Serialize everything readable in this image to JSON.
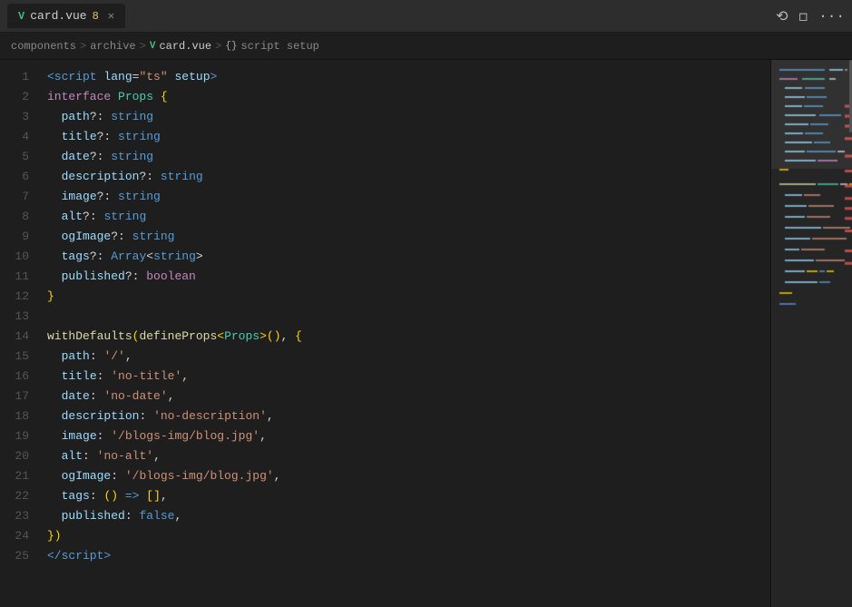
{
  "tab": {
    "label": "card.vue",
    "dirty": "8",
    "vue_prefix": "V"
  },
  "title_bar_actions": {
    "history": "⟳",
    "split": "⬜",
    "more": "···"
  },
  "breadcrumb": {
    "components": "components",
    "archive": "archive",
    "file": "card.vue",
    "section": "script setup"
  },
  "code_lines": [
    {
      "num": 1,
      "html": "<span class='t-tag'>&lt;script</span> <span class='t-attr'>lang</span><span class='t-punc'>=</span><span class='t-str'>\"ts\"</span> <span class='t-attr'>setup</span><span class='t-tag'>&gt;</span>"
    },
    {
      "num": 2,
      "html": "<span class='t-kw'>interface</span> <span class='t-typename'>Props</span> <span class='t-bracket'>{</span>"
    },
    {
      "num": 3,
      "html": "  <span class='t-prop'>path</span><span class='t-punc'>?:</span> <span class='t-kw2'>string</span>"
    },
    {
      "num": 4,
      "html": "  <span class='t-prop'>title</span><span class='t-punc'>?:</span> <span class='t-kw2'>string</span>"
    },
    {
      "num": 5,
      "html": "  <span class='t-prop'>date</span><span class='t-punc'>?:</span> <span class='t-kw2'>string</span>"
    },
    {
      "num": 6,
      "html": "  <span class='t-prop'>description</span><span class='t-punc'>?:</span> <span class='t-kw2'>string</span>"
    },
    {
      "num": 7,
      "html": "  <span class='t-prop'>image</span><span class='t-punc'>?:</span> <span class='t-kw2'>string</span>"
    },
    {
      "num": 8,
      "html": "  <span class='t-prop'>alt</span><span class='t-punc'>?:</span> <span class='t-kw2'>string</span>"
    },
    {
      "num": 9,
      "html": "  <span class='t-prop'>ogImage</span><span class='t-punc'>?:</span> <span class='t-kw2'>string</span>"
    },
    {
      "num": 10,
      "html": "  <span class='t-prop'>tags</span><span class='t-punc'>?:</span> <span class='t-kw2'>Array</span><span class='t-punc'>&lt;</span><span class='t-kw2'>string</span><span class='t-punc'>&gt;</span>"
    },
    {
      "num": 11,
      "html": "  <span class='t-prop'>published</span><span class='t-punc'>?:</span> <span class='t-kw'>boolean</span>"
    },
    {
      "num": 12,
      "html": "<span class='t-bracket'>}</span>"
    },
    {
      "num": 13,
      "html": ""
    },
    {
      "num": 14,
      "html": "<span class='t-fn'>withDefaults</span><span class='t-bracket'>(</span><span class='t-fn'>defineProps</span><span class='t-bracket'>&lt;</span><span class='t-typename'>Props</span><span class='t-bracket'>&gt;()</span><span class='t-punc'>,</span> <span class='t-bracket'>{</span>"
    },
    {
      "num": 15,
      "html": "  <span class='t-prop'>path</span><span class='t-punc'>:</span> <span class='t-val'>'/'</span><span class='t-punc'>,</span>"
    },
    {
      "num": 16,
      "html": "  <span class='t-prop'>title</span><span class='t-punc'>:</span> <span class='t-val'>'no-title'</span><span class='t-punc'>,</span>"
    },
    {
      "num": 17,
      "html": "  <span class='t-prop'>date</span><span class='t-punc'>:</span> <span class='t-val'>'no-date'</span><span class='t-punc'>,</span>"
    },
    {
      "num": 18,
      "html": "  <span class='t-prop'>description</span><span class='t-punc'>:</span> <span class='t-val'>'no-description'</span><span class='t-punc'>,</span>"
    },
    {
      "num": 19,
      "html": "  <span class='t-prop'>image</span><span class='t-punc'>:</span> <span class='t-val'>'/blogs-img/blog.jpg'</span><span class='t-punc'>,</span>"
    },
    {
      "num": 20,
      "html": "  <span class='t-prop'>alt</span><span class='t-punc'>:</span> <span class='t-val'>'no-alt'</span><span class='t-punc'>,</span>"
    },
    {
      "num": 21,
      "html": "  <span class='t-prop'>ogImage</span><span class='t-punc'>:</span> <span class='t-val'>'/blogs-img/blog.jpg'</span><span class='t-punc'>,</span>"
    },
    {
      "num": 22,
      "html": "  <span class='t-prop'>tags</span><span class='t-punc'>:</span> <span class='t-bracket'>()</span> <span class='t-arrow'>=&gt;</span> <span class='t-bracket'>[]</span><span class='t-punc'>,</span>"
    },
    {
      "num": 23,
      "html": "  <span class='t-prop'>published</span><span class='t-punc'>:</span> <span class='t-bool'>false</span><span class='t-punc'>,</span>"
    },
    {
      "num": 24,
      "html": "<span class='t-bracket'>})</span>"
    },
    {
      "num": 25,
      "html": "<span class='t-tag'>&lt;/script&gt;</span>"
    }
  ]
}
